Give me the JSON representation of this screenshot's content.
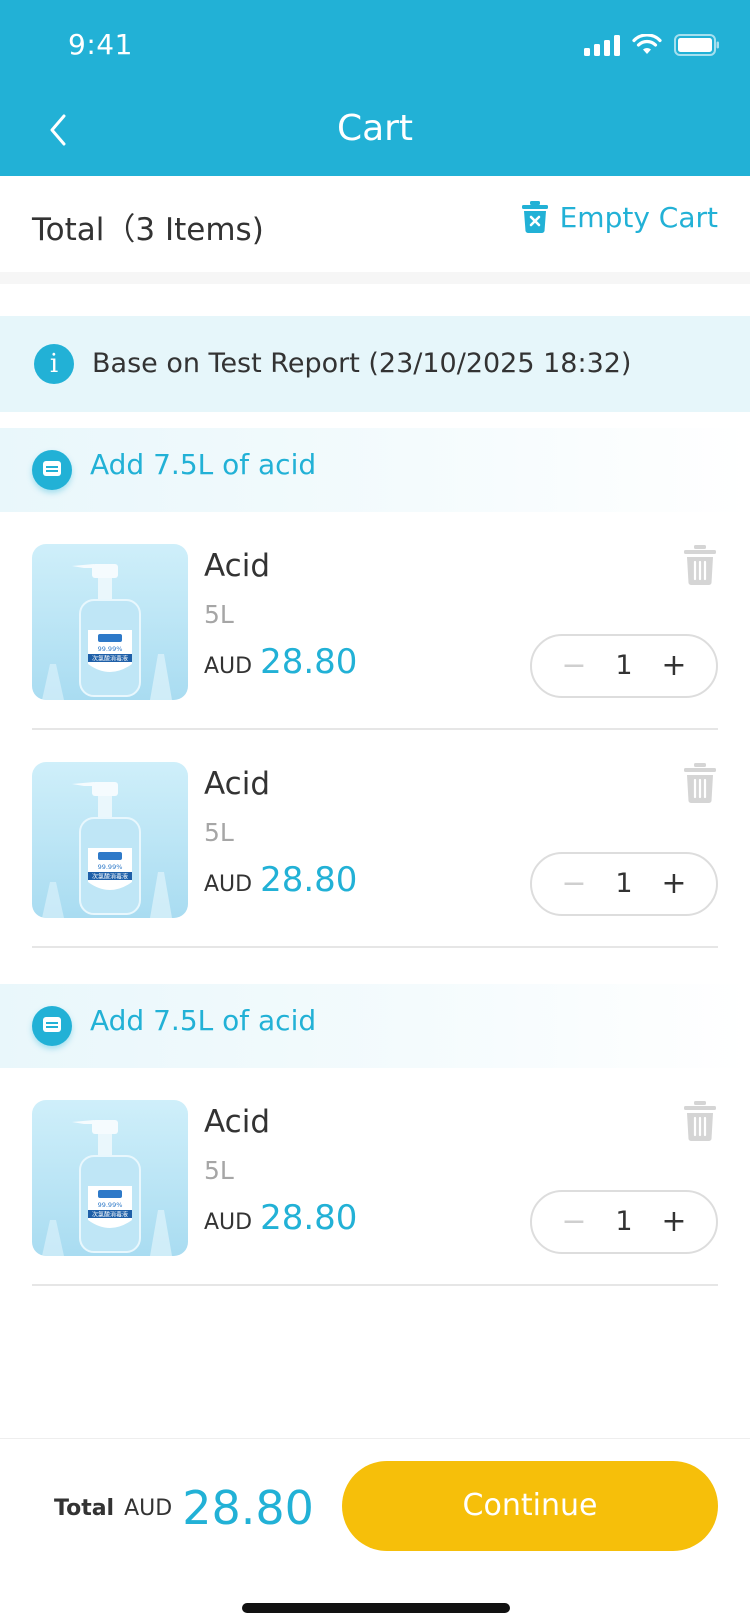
{
  "status_bar": {
    "time": "9:41"
  },
  "nav": {
    "title": "Cart"
  },
  "total_bar": {
    "total_label": "Total（3 Items)",
    "empty_cart_label": "Empty Cart"
  },
  "info_banner": {
    "text": "Base on Test Report (23/10/2025 18:32)"
  },
  "groups": [
    {
      "banner": "Add 7.5L of acid",
      "items": [
        {
          "name": "Acid",
          "spec": "5L",
          "currency": "AUD",
          "price": "28.80",
          "qty": "1"
        },
        {
          "name": "Acid",
          "spec": "5L",
          "currency": "AUD",
          "price": "28.80",
          "qty": "1"
        }
      ]
    },
    {
      "banner": "Add 7.5L of acid",
      "items": [
        {
          "name": "Acid",
          "spec": "5L",
          "currency": "AUD",
          "price": "28.80",
          "qty": "1"
        }
      ]
    }
  ],
  "stepper": {
    "minus": "−",
    "plus": "+"
  },
  "footer": {
    "total_label": "Total",
    "currency": "AUD",
    "total_value": "28.80",
    "continue_label": "Continue"
  },
  "product_image": {
    "badge_text": "99.99%",
    "label_text": "次氯酸消毒液"
  },
  "colors": {
    "accent": "#22B1D6",
    "button": "#F6BF0A",
    "header": "#22B1D6"
  },
  "icons": [
    "back-icon",
    "signal-icon",
    "wifi-icon",
    "battery-icon",
    "trash-icon",
    "info-icon",
    "message-icon",
    "delete-icon"
  ]
}
